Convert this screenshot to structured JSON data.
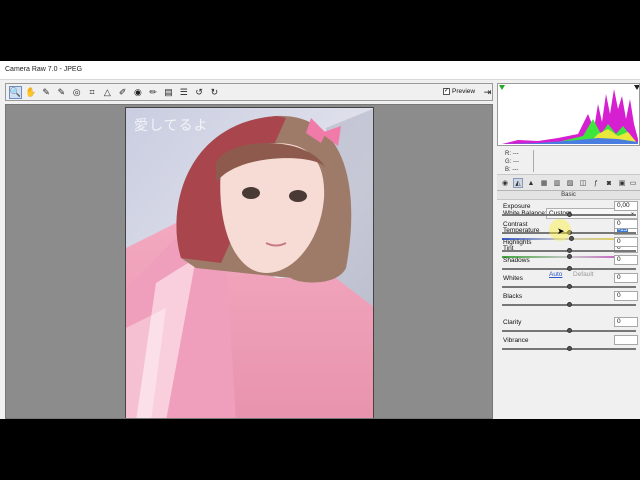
{
  "window": {
    "title": "Camera Raw 7.0  -  JPEG"
  },
  "toolbar": {
    "tools": [
      {
        "name": "zoom-tool-icon",
        "glyph": "🔍",
        "active": true
      },
      {
        "name": "hand-tool-icon",
        "glyph": "✋"
      },
      {
        "name": "white-balance-tool-icon",
        "glyph": "✎"
      },
      {
        "name": "color-sampler-tool-icon",
        "glyph": "✎"
      },
      {
        "name": "targeted-adjustment-tool-icon",
        "glyph": "◎"
      },
      {
        "name": "crop-tool-icon",
        "glyph": "⌗"
      },
      {
        "name": "straighten-tool-icon",
        "glyph": "△"
      },
      {
        "name": "spot-removal-tool-icon",
        "glyph": "✐"
      },
      {
        "name": "red-eye-removal-tool-icon",
        "glyph": "◉"
      },
      {
        "name": "adjustment-brush-icon",
        "glyph": "✏"
      },
      {
        "name": "graduated-filter-icon",
        "glyph": "▤"
      },
      {
        "name": "preferences-icon",
        "glyph": "☰"
      },
      {
        "name": "rotate-left-icon",
        "glyph": "↺"
      },
      {
        "name": "rotate-right-icon",
        "glyph": "↻"
      }
    ],
    "preview_label": "Preview",
    "preview_checked": "✓",
    "fullscreen_glyph": "⇥"
  },
  "photo": {
    "overlay_text": "愛してるよ"
  },
  "rgb_readout": {
    "r": "R:  ---",
    "g": "G:  ---",
    "b": "B:  ---"
  },
  "panel": {
    "title": "Basic",
    "white_balance": {
      "label": "White Balance:",
      "value": "Custom",
      "arrow": "⌄"
    },
    "temperature": {
      "label": "Temperature",
      "value": "-15",
      "fraction": 0.52
    },
    "tint": {
      "label": "Tint",
      "value": "0",
      "fraction": 0.5
    },
    "auto_label": "Auto",
    "default_label": "Default",
    "sliders": [
      {
        "label": "Exposure",
        "value": "0,00",
        "fraction": 0.5
      },
      {
        "label": "Contrast",
        "value": "0",
        "fraction": 0.5
      },
      {
        "label": "Highlights",
        "value": "0",
        "fraction": 0.5
      },
      {
        "label": "Shadows",
        "value": "0",
        "fraction": 0.5
      },
      {
        "label": "Whites",
        "value": "0",
        "fraction": 0.5
      },
      {
        "label": "Blacks",
        "value": "0",
        "fraction": 0.5
      },
      {
        "label": "Clarity",
        "value": "0",
        "fraction": 0.5
      },
      {
        "label": "Vibrance",
        "value": "",
        "fraction": 0.5
      }
    ]
  },
  "colors": {
    "accent": "#3a78d6",
    "link": "#2a56c6",
    "canvas": "#8c8c8c"
  }
}
